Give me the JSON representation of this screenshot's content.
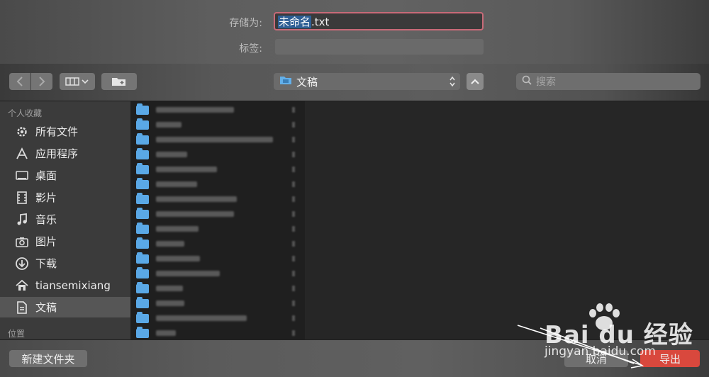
{
  "save": {
    "save_as_label": "存储为:",
    "filename_selected": "未命名",
    "filename_ext": ".txt",
    "tags_label": "标签:"
  },
  "toolbar": {
    "location": "文稿",
    "search_placeholder": "搜索"
  },
  "sidebar": {
    "favorites_header": "个人收藏",
    "items": [
      {
        "label": "所有文件",
        "icon": "gear-icon"
      },
      {
        "label": "应用程序",
        "icon": "apps-icon"
      },
      {
        "label": "桌面",
        "icon": "desktop-icon"
      },
      {
        "label": "影片",
        "icon": "film-icon"
      },
      {
        "label": "音乐",
        "icon": "music-icon"
      },
      {
        "label": "图片",
        "icon": "camera-icon"
      },
      {
        "label": "下载",
        "icon": "download-icon"
      },
      {
        "label": "tiansemixiang",
        "icon": "home-icon"
      },
      {
        "label": "文稿",
        "icon": "document-icon",
        "active": true
      }
    ],
    "locations_header": "位置"
  },
  "bottom": {
    "new_folder": "新建文件夹",
    "cancel": "取消",
    "export": "导出"
  },
  "watermark": {
    "brand": "Bai du 经验",
    "url": "jingyan.baidu.com"
  }
}
